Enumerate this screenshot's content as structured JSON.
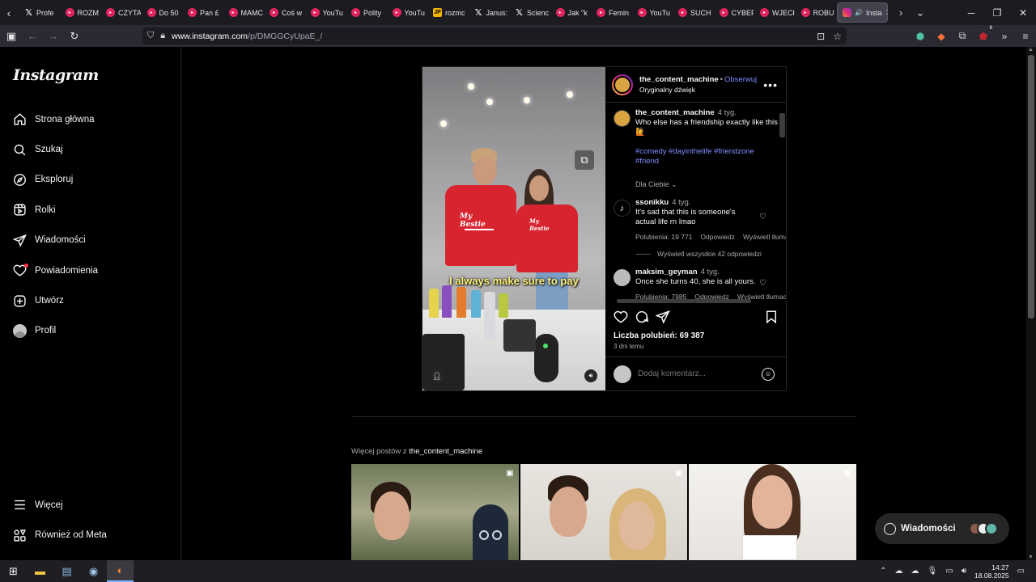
{
  "browser": {
    "tabs": [
      {
        "label": "Profe",
        "icon": "x-icon"
      },
      {
        "label": "ROZM",
        "icon": "dot-icon",
        "color": "#e0245e"
      },
      {
        "label": "CZYTA",
        "icon": "dot-icon",
        "color": "#e0245e"
      },
      {
        "label": "Do 50",
        "icon": "dot-icon",
        "color": "#e0245e"
      },
      {
        "label": "Pan £",
        "icon": "dot-icon",
        "color": "#e0245e"
      },
      {
        "label": "MAMC",
        "icon": "dot-icon",
        "color": "#e0245e"
      },
      {
        "label": "Coś w",
        "icon": "dot-icon",
        "color": "#e0245e"
      },
      {
        "label": "YouTu",
        "icon": "dot-icon",
        "color": "#e0245e"
      },
      {
        "label": "Polity",
        "icon": "dot-icon",
        "color": "#e0245e"
      },
      {
        "label": "YouTu",
        "icon": "dot-icon",
        "color": "#e0245e"
      },
      {
        "label": "rozmc",
        "icon": "jp-icon"
      },
      {
        "label": "Janus:",
        "icon": "x-icon"
      },
      {
        "label": "Scienc",
        "icon": "x-icon"
      },
      {
        "label": "Jak \"k",
        "icon": "dot-icon",
        "color": "#e0245e"
      },
      {
        "label": "Femin",
        "icon": "dot-icon",
        "color": "#e0245e"
      },
      {
        "label": "YouTu",
        "icon": "dot-icon",
        "color": "#e0245e"
      },
      {
        "label": "SUCH",
        "icon": "dot-icon",
        "color": "#e0245e"
      },
      {
        "label": "CYBEF",
        "icon": "dot-icon",
        "color": "#e0245e"
      },
      {
        "label": "WJECł",
        "icon": "dot-icon",
        "color": "#e0245e"
      },
      {
        "label": "ROBU",
        "icon": "dot-icon",
        "color": "#e0245e"
      }
    ],
    "active_tab": {
      "label": "Insta",
      "icon": "instagram-icon"
    },
    "url_host": "www.instagram.com",
    "url_path": "/p/DMGGCyUpaE_/",
    "ext_badge": "8"
  },
  "sidebar": {
    "logo": "Instagram",
    "items": [
      {
        "label": "Strona główna",
        "icon": "home-icon"
      },
      {
        "label": "Szukaj",
        "icon": "search-icon"
      },
      {
        "label": "Eksploruj",
        "icon": "compass-icon"
      },
      {
        "label": "Rolki",
        "icon": "reels-icon"
      },
      {
        "label": "Wiadomości",
        "icon": "send-icon"
      },
      {
        "label": "Powiadomienia",
        "icon": "heart-icon"
      },
      {
        "label": "Utwórz",
        "icon": "plus-icon"
      },
      {
        "label": "Profil",
        "icon": "avatar-icon"
      }
    ],
    "bottom": [
      {
        "label": "Więcej",
        "icon": "menu-icon"
      },
      {
        "label": "Również od Meta",
        "icon": "meta-icon"
      }
    ]
  },
  "post": {
    "video_caption": "I always make sure to pay",
    "shirt_text": "My Bestie",
    "author": "the_content_machine",
    "follow": "Obserwuj",
    "audio": "Oryginalny dźwięk",
    "caption": {
      "user": "the_content_machine",
      "time": "4 tyg.",
      "text": "Who else has a friendship exactly like this 🙋",
      "hashtags": "#comedy #dayinthelife #friendzone #friend",
      "filter": "Dla Ciebie"
    },
    "comments": [
      {
        "user": "ssonikku",
        "time": "4 tyg.",
        "text": "It's sad that this is someone's actual life rn lmao",
        "likes": "Polubienia: 19 771",
        "reply": "Odpowiedz",
        "translate": "Wyświetl tłumaczenie",
        "view_replies": "Wyświetl wszystkie 42 odpowiedzi"
      },
      {
        "user": "maksim_geyman",
        "time": "4 tyg.",
        "text": "Once she turns 40, she is all yours.",
        "likes": "Polubienia: 7985",
        "reply": "Odpowiedz",
        "translate": "Wyświetl tłumaczenie"
      }
    ],
    "likes_count": "Liczba polubień: 69 387",
    "date": "3 dni temu",
    "comment_placeholder": "Dodaj komentarz..."
  },
  "more_posts": {
    "label": "Więcej postów z",
    "user": "the_content_machine"
  },
  "messages_pill": {
    "label": "Wiadomości"
  },
  "taskbar": {
    "time": "14:27",
    "date": "18.08.2025"
  },
  "colors": {
    "link": "#7e8cff",
    "notification": "#ff3040",
    "caption_yellow": "#fff27a",
    "shirt_red": "#d8242f"
  }
}
